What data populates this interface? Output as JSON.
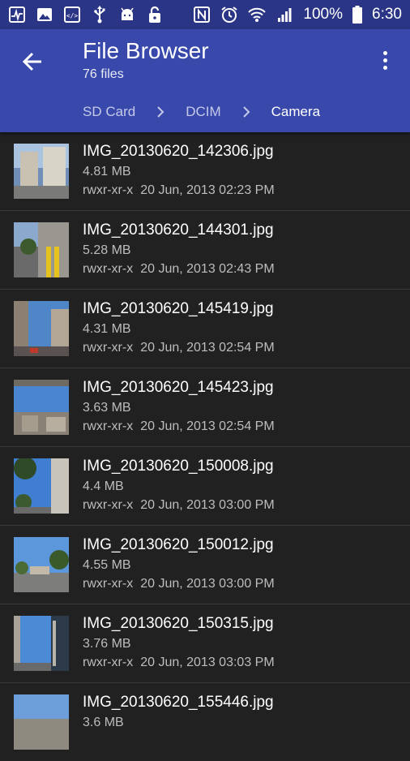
{
  "statusbar": {
    "left_icons": [
      "activity-icon",
      "image-icon",
      "code-icon",
      "usb-icon",
      "android-icon",
      "lock-open-icon"
    ],
    "right_icons": [
      "nfc-icon",
      "alarm-icon",
      "wifi-icon",
      "signal-icon"
    ],
    "battery": "100%",
    "time": "6:30"
  },
  "appbar": {
    "title": "File Browser",
    "subtitle": "76 files",
    "breadcrumb": [
      "SD Card",
      "DCIM",
      "Camera"
    ]
  },
  "files": [
    {
      "name": "IMG_20130620_142306.jpg",
      "size": "4.81 MB",
      "perm": "rwxr-xr-x",
      "date": "20 Jun, 2013 02:23 PM"
    },
    {
      "name": "IMG_20130620_144301.jpg",
      "size": "5.28 MB",
      "perm": "rwxr-xr-x",
      "date": "20 Jun, 2013 02:43 PM"
    },
    {
      "name": "IMG_20130620_145419.jpg",
      "size": "4.31 MB",
      "perm": "rwxr-xr-x",
      "date": "20 Jun, 2013 02:54 PM"
    },
    {
      "name": "IMG_20130620_145423.jpg",
      "size": "3.63 MB",
      "perm": "rwxr-xr-x",
      "date": "20 Jun, 2013 02:54 PM"
    },
    {
      "name": "IMG_20130620_150008.jpg",
      "size": "4.4 MB",
      "perm": "rwxr-xr-x",
      "date": "20 Jun, 2013 03:00 PM"
    },
    {
      "name": "IMG_20130620_150012.jpg",
      "size": "4.55 MB",
      "perm": "rwxr-xr-x",
      "date": "20 Jun, 2013 03:00 PM"
    },
    {
      "name": "IMG_20130620_150315.jpg",
      "size": "3.76 MB",
      "perm": "rwxr-xr-x",
      "date": "20 Jun, 2013 03:03 PM"
    },
    {
      "name": "IMG_20130620_155446.jpg",
      "size": "3.6 MB",
      "perm": "",
      "date": ""
    }
  ],
  "colors": {
    "appbar": "#3949ab",
    "statusbar": "#2a3586",
    "background": "#212121"
  }
}
